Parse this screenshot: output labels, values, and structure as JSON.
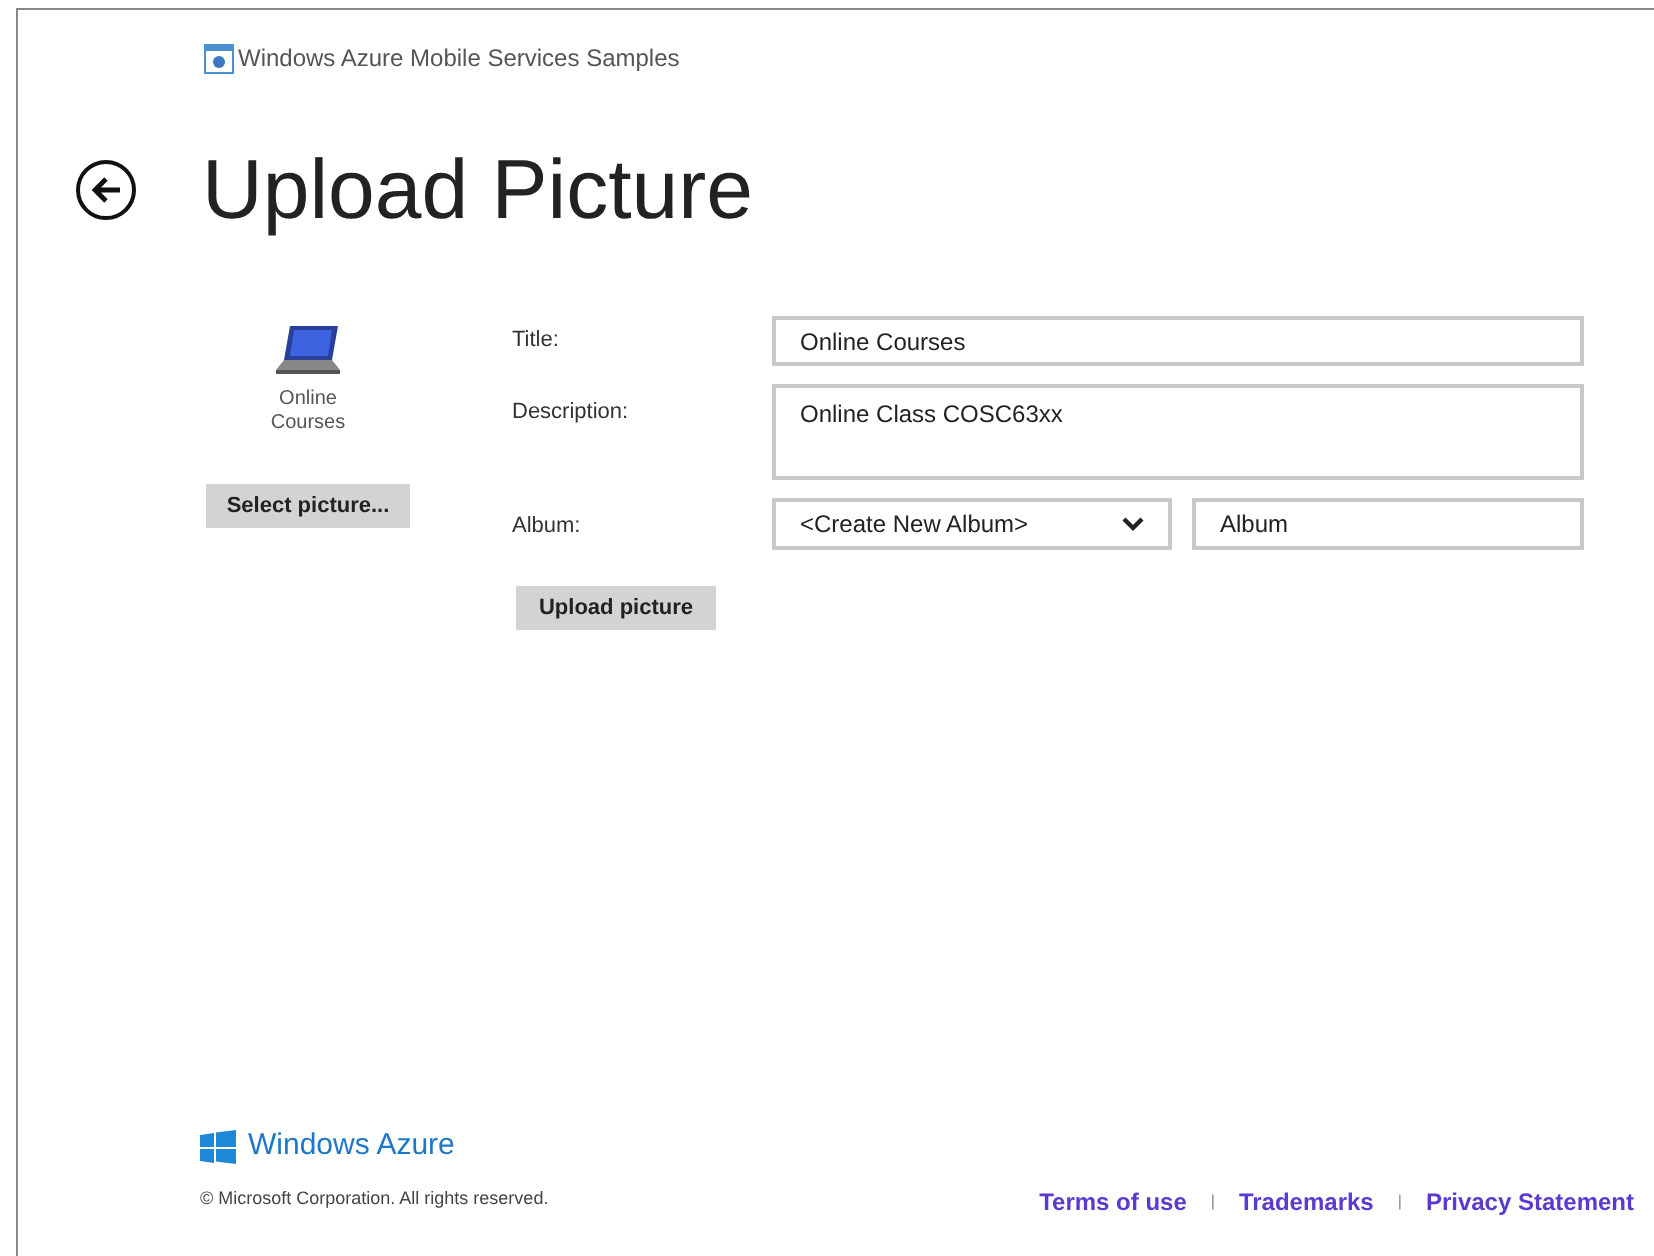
{
  "app_header": {
    "title": "Windows Azure Mobile Services Samples"
  },
  "page_title": "Upload Picture",
  "preview": {
    "caption": "Online Courses"
  },
  "select_button": "Select picture...",
  "form": {
    "fields": [
      {
        "label": "Title:",
        "kind": "text",
        "value": "Online Courses"
      },
      {
        "label": "Description:",
        "kind": "textarea",
        "value": "Online Class COSC63xx"
      },
      {
        "label": "Album:",
        "kind": "album",
        "value": "<Create New Album>",
        "placeholder": "Album"
      }
    ],
    "upload_button": "Upload picture"
  },
  "footer": {
    "brand": "Windows Azure",
    "copyright": "© Microsoft Corporation. All rights reserved.",
    "links": [
      "Terms of use",
      "Trademarks",
      "Privacy Statement"
    ],
    "separator": "|"
  }
}
